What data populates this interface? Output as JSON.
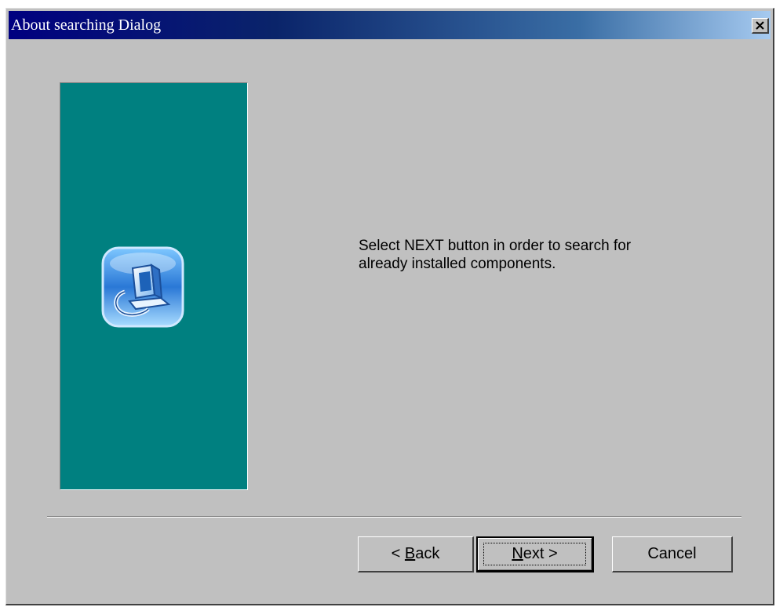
{
  "window": {
    "title": "About searching Dialog"
  },
  "content": {
    "message_line1": "Select NEXT button in order to search for",
    "message_line2": "already installed components."
  },
  "buttons": {
    "back_prefix": "< ",
    "back_mnemonic": "B",
    "back_rest": "ack",
    "next_mnemonic": "N",
    "next_rest": "ext >",
    "cancel": "Cancel"
  },
  "icons": {
    "close": "close-icon",
    "setup": "computer-setup-icon"
  },
  "colors": {
    "dialog_face": "#c0c0c0",
    "side_panel": "#008080",
    "titlebar_start": "#000080",
    "titlebar_end": "#a6caf0"
  }
}
